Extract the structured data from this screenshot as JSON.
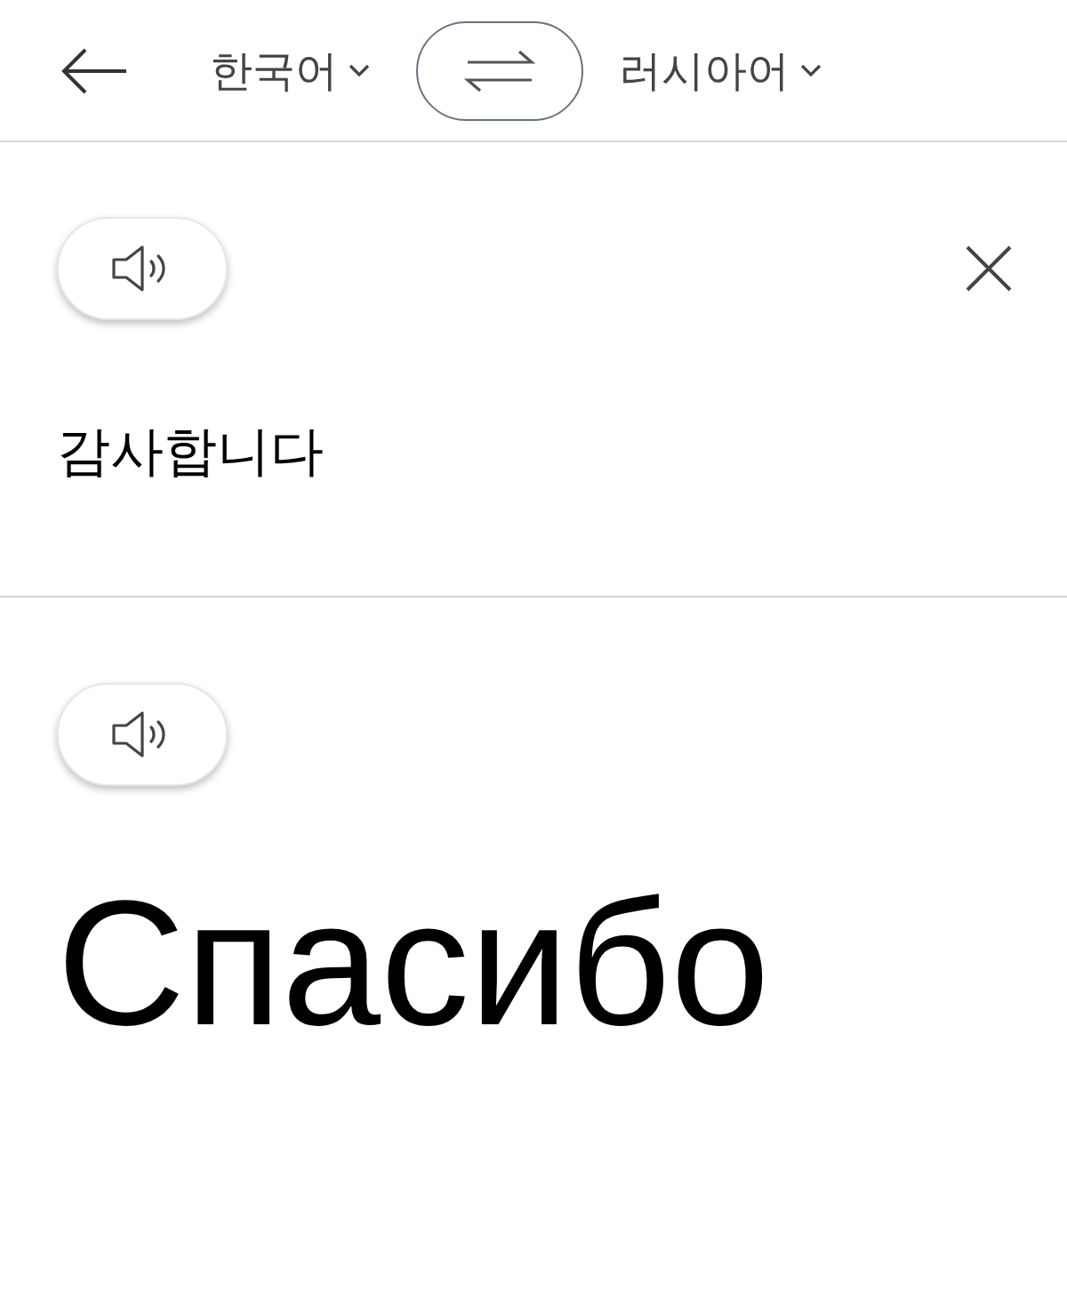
{
  "header": {
    "source_language": "한국어",
    "target_language": "러시아어"
  },
  "source": {
    "text": "감사합니다"
  },
  "translation": {
    "text": "Спасибо"
  }
}
